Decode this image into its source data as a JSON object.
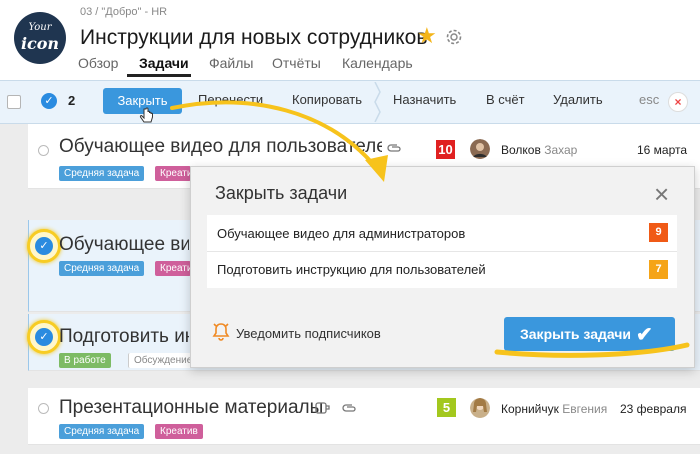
{
  "header": {
    "logo_line1": "Your",
    "logo_line2": "icon",
    "breadcrumb": "03 / \"Добро\" - HR",
    "title": "Инструкции для новых сотрудников",
    "tabs": [
      "Обзор",
      "Задачи",
      "Файлы",
      "Отчёты",
      "Календарь"
    ],
    "active_tab": "Задачи"
  },
  "toolbar": {
    "selected_count": "2",
    "buttons": [
      "Закрыть",
      "Перенести",
      "Копировать",
      "Назначить",
      "В счёт",
      "Удалить",
      "esc"
    ],
    "close_icon": "×"
  },
  "tasks": [
    {
      "title": "Обучающее видео для пользователей",
      "tags": [
        "Средняя задача",
        "Креатив"
      ],
      "priority": "10",
      "assignee_last": "Волков",
      "assignee_first": "Захар",
      "date": "16 марта"
    },
    {
      "title": "Обучающее видео для администраторов",
      "tags": [
        "Средняя задача",
        "Креатив"
      ]
    },
    {
      "title": "Подготовить инструкцию для пользователей",
      "tags": [
        "В работе",
        "Обсуждение"
      ]
    },
    {
      "title": "Презентационные материалы",
      "tags": [
        "Средняя задача",
        "Креатив"
      ],
      "priority": "5",
      "assignee_last": "Корнийчук",
      "assignee_first": "Евгения",
      "date": "23 февраля"
    }
  ],
  "modal": {
    "title": "Закрыть задачи",
    "items": [
      {
        "label": "Обучающее видео для администраторов",
        "priority": "9"
      },
      {
        "label": "Подготовить инструкцию для пользователей",
        "priority": "7"
      }
    ],
    "notify_label": "Уведомить подписчиков",
    "submit_label": "Закрыть задачи"
  },
  "colors": {
    "accent": "#3a97dd",
    "highlight": "#f7cc24",
    "priority_10": "#e02020",
    "priority_9": "#f05a16",
    "priority_7": "#f5a417",
    "priority_5": "#a3c81e"
  }
}
